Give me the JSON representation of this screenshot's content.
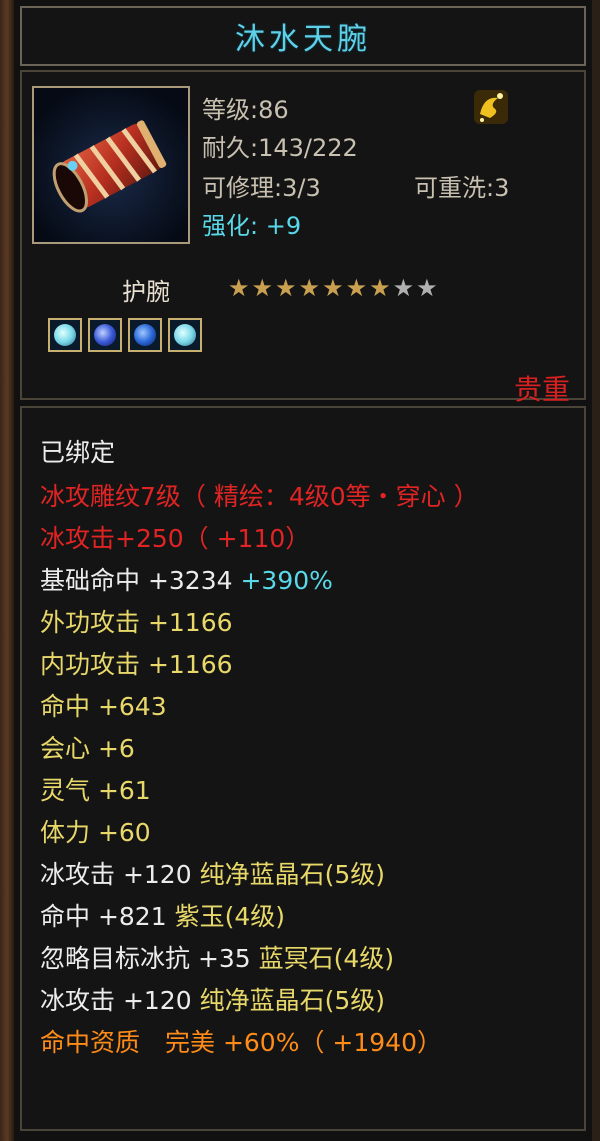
{
  "item": {
    "name": "沐水天腕",
    "level": "等级:86",
    "durability": "耐久:143/222",
    "repairable": "可修理:3/3",
    "rewashable": "可重洗:3",
    "enhance_label": "强化:",
    "enhance_value": "+9",
    "type": "护腕",
    "stars_filled": 7,
    "stars_total": 9,
    "rarity": "贵重",
    "gem_colors": [
      "#7ad8e8",
      "#3a5ad8",
      "#2a68d8",
      "#7ad8e8"
    ]
  },
  "attributes": {
    "bound": "已绑定",
    "carving": "冰攻雕纹7级（ 精绘：4级0等・穿心 ）",
    "ice_attack_main": "冰攻击+250（ +110）",
    "base_hit_label": "基础命中 +3234",
    "base_hit_bonus": "+390%",
    "outer_attack": "外功攻击 +1166",
    "inner_attack": "内功攻击 +1166",
    "hit": "命中 +643",
    "crit": "会心 +6",
    "spirit": "灵气 +61",
    "stamina": "体力 +60",
    "gem1_stat": "冰攻击 +120",
    "gem1_name": "纯净蓝晶石(5级)",
    "gem2_stat": "命中 +821",
    "gem2_name": "紫玉(4级)",
    "gem3_stat": "忽略目标冰抗 +35",
    "gem3_name": "蓝冥石(4级)",
    "gem4_stat": "冰攻击 +120",
    "gem4_name": "纯净蓝晶石(5级)",
    "aptitude": "命中资质　完美 +60%（ +1940）"
  },
  "colors": {
    "title": "#5fd0e8",
    "rarity": "#d82020",
    "red_text": "#e02424",
    "yellow_text": "#e8d86a",
    "cyan_text": "#58d8e8",
    "orange_text": "#ff8c18"
  }
}
